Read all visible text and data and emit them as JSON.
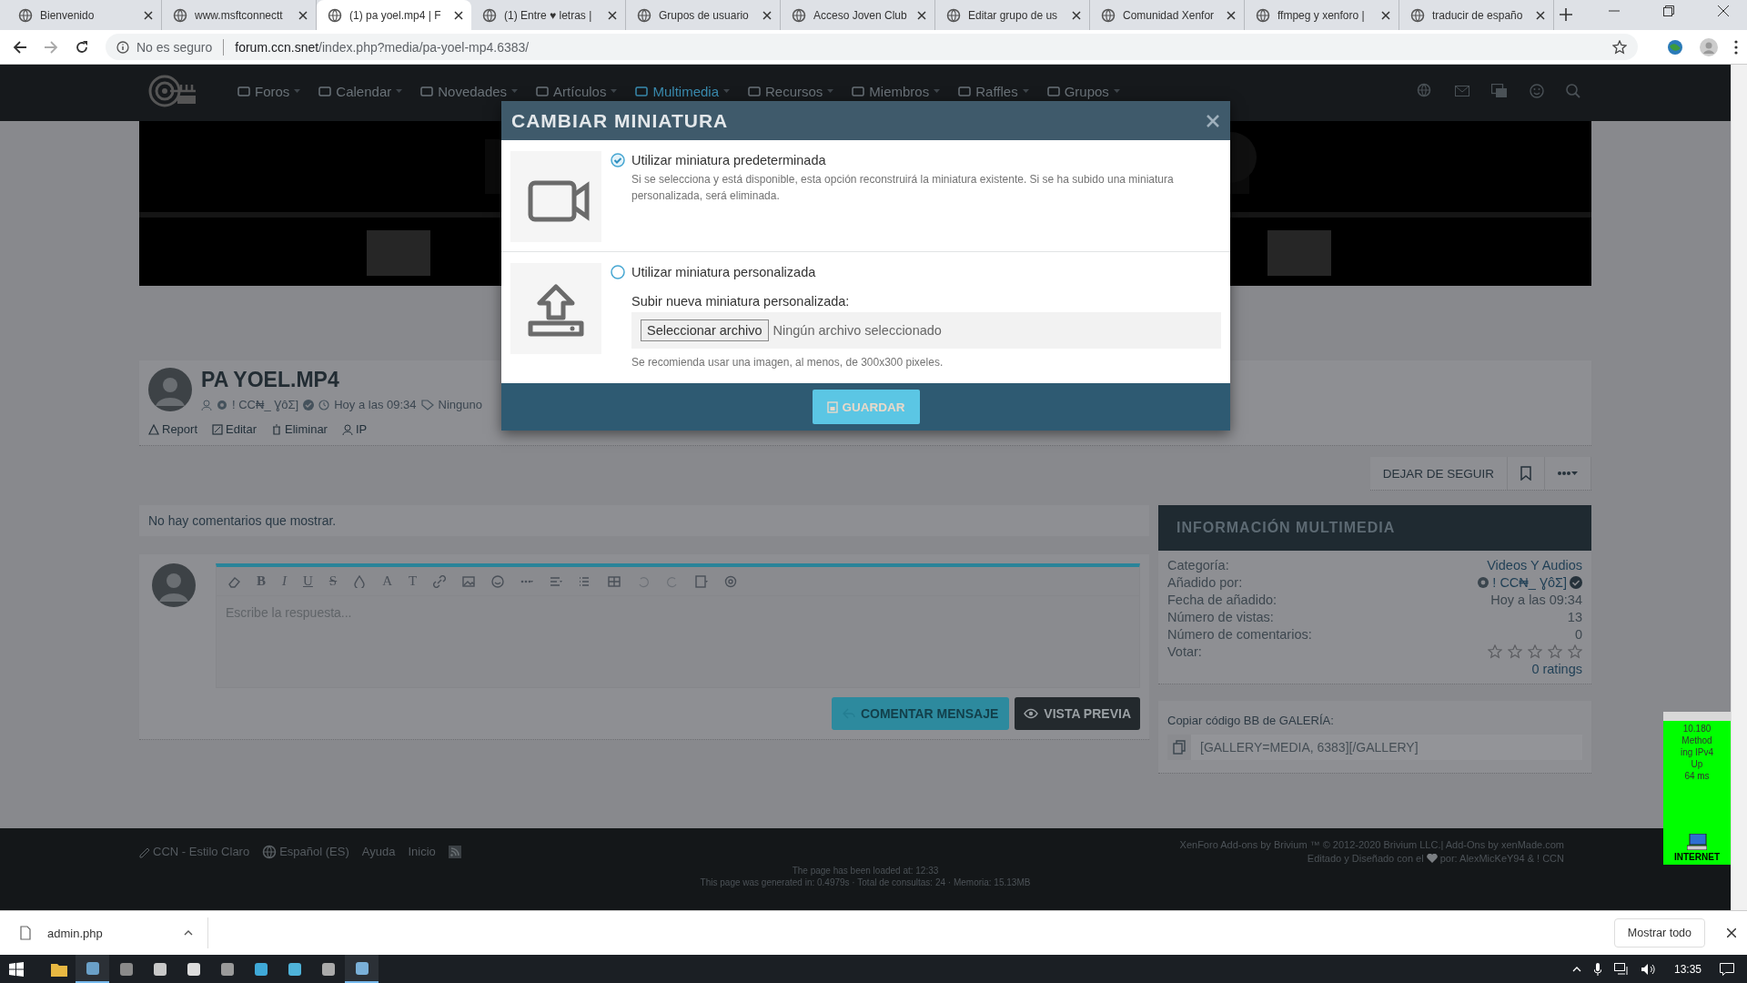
{
  "browser": {
    "tabs": [
      {
        "title": "Bienvenido",
        "selected": false
      },
      {
        "title": "www.msftconnectt",
        "selected": false
      },
      {
        "title": "(1) pa yoel.mp4 | F",
        "selected": true
      },
      {
        "title": "(1) Entre ♥ letras |",
        "selected": false
      },
      {
        "title": "Grupos de usuario",
        "selected": false
      },
      {
        "title": "Acceso Joven Club",
        "selected": false
      },
      {
        "title": "Editar grupo de us",
        "selected": false
      },
      {
        "title": "Comunidad Xenfor",
        "selected": false
      },
      {
        "title": "ffmpeg y xenforo |",
        "selected": false
      },
      {
        "title": "traducir de españo",
        "selected": false
      }
    ],
    "security": "No es seguro",
    "url_host": "forum.ccn.snet",
    "url_path": "/index.php?media/pa-yoel-mp4.6383/"
  },
  "nav": {
    "items": [
      {
        "label": "Foros",
        "selected": false
      },
      {
        "label": "Calendar",
        "selected": false
      },
      {
        "label": "Novedades",
        "selected": false
      },
      {
        "label": "Artículos",
        "selected": false
      },
      {
        "label": "Multimedia",
        "selected": true
      },
      {
        "label": "Recursos",
        "selected": false
      },
      {
        "label": "Miembros",
        "selected": false
      },
      {
        "label": "Raffles",
        "selected": false
      },
      {
        "label": "Grupos",
        "selected": false
      }
    ]
  },
  "media": {
    "title": "PA YOEL.MP4",
    "author": "! CC₦_ ƔôΣ]",
    "date": "Hoy a las 09:34",
    "tags": "Ninguno",
    "actions": [
      "Report",
      "Editar",
      "Eliminar",
      "IP"
    ],
    "follow": "DEJAR DE SEGUIR"
  },
  "comments": {
    "empty": "No hay comentarios que mostrar.",
    "letters": [
      "B",
      "I",
      "U",
      "S",
      "A",
      "T"
    ],
    "placeholder": "Escribe la respuesta...",
    "submit": "COMENTAR MENSAJE",
    "preview": "VISTA PREVIA"
  },
  "info": {
    "title": "INFORMACIÓN MULTIMEDIA",
    "rows": [
      {
        "label": "Categoría:",
        "value": "Videos Y Audios",
        "kind": "link"
      },
      {
        "label": "Añadido por:",
        "value": "! CC₦_ ƔôΣ]",
        "kind": "user"
      },
      {
        "label": "Fecha de añadido:",
        "value": "Hoy a las 09:34",
        "kind": "text"
      },
      {
        "label": "Número de vistas:",
        "value": "13",
        "kind": "text"
      },
      {
        "label": "Número de comentarios:",
        "value": "0",
        "kind": "text"
      }
    ],
    "vote_label": "Votar:",
    "stars": 0,
    "ratings": "0 ratings",
    "bb_label": "Copiar código BB de GALERÍA:",
    "bb_code": "[GALLERY=MEDIA, 6383][/GALLERY]"
  },
  "footer": {
    "links": [
      "CCN - Estilo Claro",
      "Español (ES)",
      "Ayuda",
      "Inicio"
    ],
    "credit_1": "XenForo Add-ons by Brivium ™ © 2012-2020 Brivium LLC.| Add-Ons by xenMade.com",
    "credit_2a": "Editado y Diseñado con el",
    "credit_2b": "por: AlexMicKeY94 & ! CCN",
    "loaded": "The page has been loaded at: 12:33",
    "generated": "This page was generated in: 0.4979s · Total de consultas: 24 · Memoria: 15.13MB"
  },
  "modal": {
    "title": "CAMBIAR MINIATURA",
    "options": [
      {
        "label": "Utilizar miniatura predeterminada",
        "selected": true,
        "kind": "default",
        "hint": "Si se selecciona y está disponible, esta opción reconstruirá la miniatura existente. Si se ha subido una miniatura personalizada, será eliminada."
      },
      {
        "label": "Utilizar miniatura personalizada",
        "selected": false,
        "kind": "custom",
        "upload_label": "Subir nueva miniatura personalizada:",
        "file_button": "Seleccionar archivo",
        "file_status": "Ningún archivo seleccionado",
        "hint": "Se recomienda usar una imagen, al menos, de 300x300 pixeles."
      }
    ],
    "save": "GUARDAR"
  },
  "widget": {
    "lines": [
      "10.180",
      "Method",
      "ing IPv4",
      "Up",
      "64 ms"
    ],
    "label": "INTERNET"
  },
  "downloads": {
    "file": "admin.php",
    "show_all": "Mostrar todo"
  },
  "taskbar": {
    "clock": "13:35"
  }
}
